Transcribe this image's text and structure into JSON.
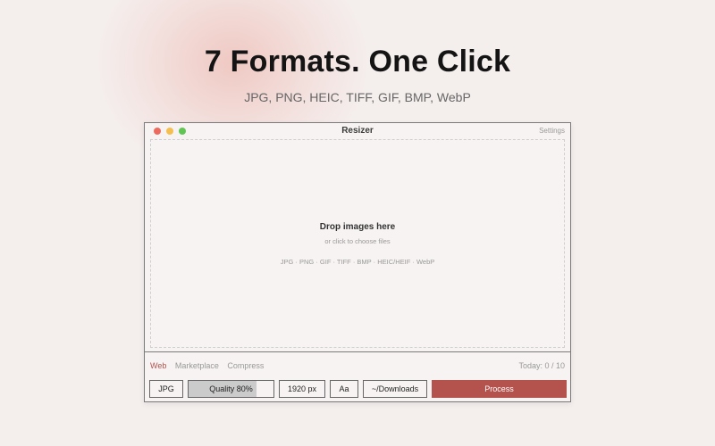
{
  "hero": {
    "headline": "7 Formats. One Click",
    "subline": "JPG, PNG, HEIC, TIFF, GIF, BMP, WebP"
  },
  "window": {
    "title": "Resizer",
    "settings_label": "Settings"
  },
  "dropzone": {
    "title": "Drop images here",
    "subtitle": "or click to choose files",
    "formats": "JPG · PNG · GIF · TIFF · BMP · HEIC/HEIF · WebP"
  },
  "tabs": [
    {
      "label": "Web",
      "active": true
    },
    {
      "label": "Marketplace",
      "active": false
    },
    {
      "label": "Compress",
      "active": false
    }
  ],
  "usage": "Today: 0 / 10",
  "controls": {
    "format": "JPG",
    "quality_label": "Quality 80%",
    "quality_value": 0.8,
    "size": "1920 px",
    "font": "Aa",
    "destination": "~/Downloads",
    "process": "Process"
  },
  "colors": {
    "accent": "#b4524d",
    "background": "#f4eeed",
    "traffic_red": "#ec6a5e",
    "traffic_yellow": "#f4bf4f",
    "traffic_green": "#61c554"
  }
}
